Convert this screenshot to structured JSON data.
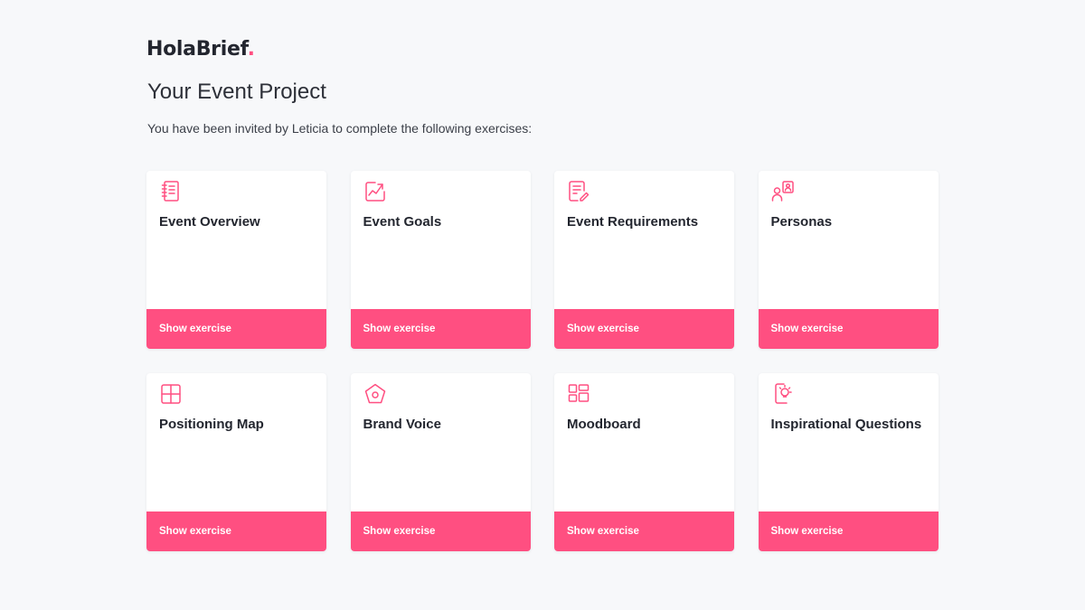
{
  "brand": {
    "name": "HolaBrief",
    "dot": ".",
    "accent_color": "#ff4f81"
  },
  "header": {
    "title": "Your Event Project",
    "subtitle": "You have been invited by Leticia to complete the following exercises:"
  },
  "exercises": [
    {
      "title": "Event Overview",
      "icon": "notebook-icon",
      "button": "Show exercise"
    },
    {
      "title": "Event Goals",
      "icon": "growth-chart-icon",
      "button": "Show exercise"
    },
    {
      "title": "Event Requirements",
      "icon": "document-edit-icon",
      "button": "Show exercise"
    },
    {
      "title": "Personas",
      "icon": "user-profile-icon",
      "button": "Show exercise"
    },
    {
      "title": "Positioning Map",
      "icon": "grid-quadrant-icon",
      "button": "Show exercise"
    },
    {
      "title": "Brand Voice",
      "icon": "pentagon-icon",
      "button": "Show exercise"
    },
    {
      "title": "Moodboard",
      "icon": "dashboard-layout-icon",
      "button": "Show exercise"
    },
    {
      "title": "Inspirational Questions",
      "icon": "lightbulb-phone-icon",
      "button": "Show exercise"
    }
  ]
}
